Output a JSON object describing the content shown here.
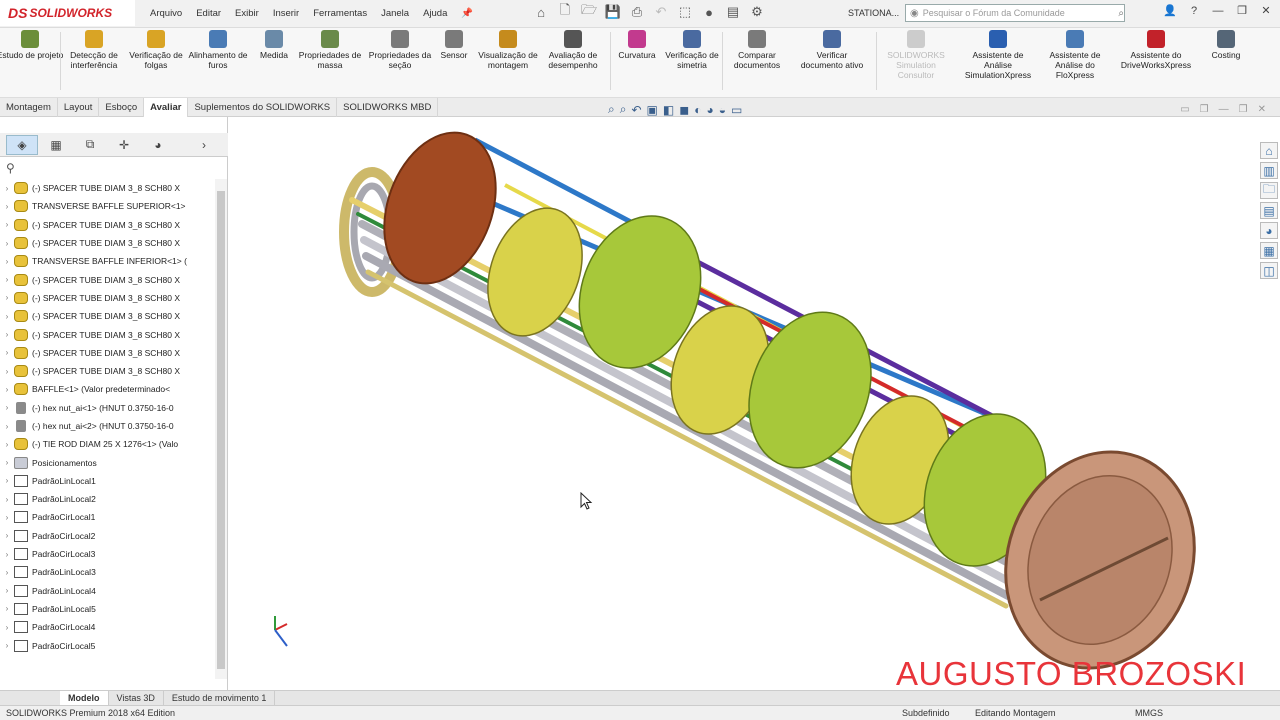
{
  "app": {
    "logo_ds": "DS",
    "logo_name": "SOLIDWORKS",
    "menus": [
      "Arquivo",
      "Editar",
      "Exibir",
      "Inserir",
      "Ferramentas",
      "Janela",
      "Ajuda"
    ],
    "doc_name": "STATIONA...",
    "search_placeholder": "Pesquisar o Fórum da Comunidade"
  },
  "ribbon": [
    {
      "label": "Estudo de projeto",
      "color": "#6b8e3a"
    },
    {
      "label": "Detecção de interferência",
      "color": "#d9a425"
    },
    {
      "label": "Verificação de folgas",
      "color": "#d9a425"
    },
    {
      "label": "Alinhamento de furos",
      "color": "#4a7bb5"
    },
    {
      "label": "Medida",
      "color": "#6a8aa8"
    },
    {
      "label": "Propriedades de massa",
      "color": "#6a8a4a"
    },
    {
      "label": "Propriedades da seção",
      "color": "#7a7a7a"
    },
    {
      "label": "Sensor",
      "color": "#7a7a7a"
    },
    {
      "label": "Visualização de montagem",
      "color": "#c58b1d"
    },
    {
      "label": "Avaliação de desempenho",
      "color": "#555555"
    },
    {
      "label": "Curvatura",
      "color": "#c23a8e"
    },
    {
      "label": "Verificação de simetria",
      "color": "#4a6aa0"
    },
    {
      "label": "Comparar documentos",
      "color": "#7a7a7a"
    },
    {
      "label": "Verificar documento ativo",
      "color": "#4a6aa0"
    },
    {
      "label": "SOLIDWORKS Simulation Consultor",
      "color": "#cccccc"
    },
    {
      "label": "Assistente de Análise SimulationXpress",
      "color": "#2a5fb0"
    },
    {
      "label": "Assistente de Análise do FloXpress",
      "color": "#4a7bb5"
    },
    {
      "label": "Assistente do DriveWorksXpress",
      "color": "#c2222a"
    },
    {
      "label": "Costing",
      "color": "#556677"
    }
  ],
  "command_tabs": [
    "Montagem",
    "Layout",
    "Esboço",
    "Avaliar",
    "Suplementos do SOLIDWORKS",
    "SOLIDWORKS MBD"
  ],
  "active_tab": "Avaliar",
  "tree": [
    {
      "label": "(-) SPACER TUBE DIAM 3_8 SCH80 X",
      "type": "part"
    },
    {
      "label": "TRANSVERSE BAFFLE SUPERIOR<1>",
      "type": "part"
    },
    {
      "label": "(-) SPACER TUBE DIAM 3_8 SCH80 X",
      "type": "part"
    },
    {
      "label": "(-) SPACER TUBE DIAM 3_8 SCH80 X",
      "type": "part"
    },
    {
      "label": "TRANSVERSE BAFFLE INFERIOR<1> (",
      "type": "part"
    },
    {
      "label": "(-) SPACER TUBE DIAM 3_8 SCH80 X",
      "type": "part"
    },
    {
      "label": "(-) SPACER TUBE DIAM 3_8 SCH80 X",
      "type": "part"
    },
    {
      "label": "(-) SPACER TUBE DIAM 3_8 SCH80 X",
      "type": "part"
    },
    {
      "label": "(-) SPACER TUBE DIAM 3_8 SCH80 X",
      "type": "part"
    },
    {
      "label": "(-) SPACER TUBE DIAM 3_8 SCH80 X",
      "type": "part"
    },
    {
      "label": "(-) SPACER TUBE DIAM 3_8 SCH80 X",
      "type": "part"
    },
    {
      "label": "BAFFLE<1> (Valor predeterminado<",
      "type": "part"
    },
    {
      "label": "(-) hex nut_ai<1> (HNUT 0.3750-16-0",
      "type": "bolt"
    },
    {
      "label": "(-) hex nut_ai<2> (HNUT 0.3750-16-0",
      "type": "bolt"
    },
    {
      "label": "(-) TIE ROD DIAM 25 X 1276<1> (Valo",
      "type": "part"
    },
    {
      "label": "Posicionamentos",
      "type": "mate"
    },
    {
      "label": "PadrãoLinLocal1",
      "type": "pat"
    },
    {
      "label": "PadrãoLinLocal2",
      "type": "pat"
    },
    {
      "label": "PadrãoCirLocal1",
      "type": "pat"
    },
    {
      "label": "PadrãoCirLocal2",
      "type": "pat"
    },
    {
      "label": "PadrãoCirLocal3",
      "type": "pat"
    },
    {
      "label": "PadrãoLinLocal3",
      "type": "pat"
    },
    {
      "label": "PadrãoLinLocal4",
      "type": "pat"
    },
    {
      "label": "PadrãoLinLocal5",
      "type": "pat"
    },
    {
      "label": "PadrãoCirLocal4",
      "type": "pat"
    },
    {
      "label": "PadrãoCirLocal5",
      "type": "pat"
    }
  ],
  "bottom_tabs": [
    "Modelo",
    "Vistas 3D",
    "Estudo de movimento 1"
  ],
  "status": {
    "edition": "SOLIDWORKS Premium 2018 x64 Edition",
    "state": "Subdefinido",
    "mode": "Editando Montagem",
    "units": "MMGS"
  },
  "watermark": "AUGUSTO BROZOSKI"
}
